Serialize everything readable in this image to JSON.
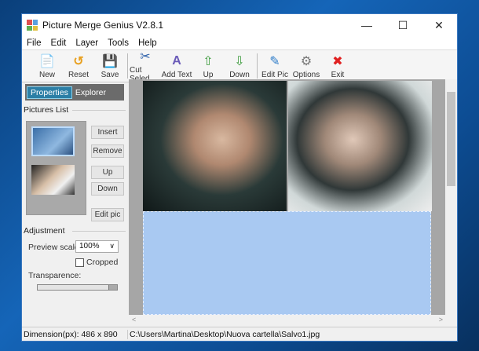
{
  "window": {
    "title": "Picture Merge Genius V2.8.1",
    "minimize": "—",
    "maximize": "☐",
    "close": "✕"
  },
  "menu": [
    "File",
    "Edit",
    "Layer",
    "Tools",
    "Help"
  ],
  "toolbar": [
    {
      "label": "New",
      "icon": "📄"
    },
    {
      "label": "Reset",
      "icon": "↺"
    },
    {
      "label": "Save",
      "icon": "💾"
    },
    {
      "label": "Cut Seled",
      "icon": "✂"
    },
    {
      "label": "Add Text",
      "icon": "A"
    },
    {
      "label": "Up",
      "icon": "⇧"
    },
    {
      "label": "Down",
      "icon": "⇩"
    },
    {
      "label": "Edit Pic",
      "icon": "✎"
    },
    {
      "label": "Options",
      "icon": "⚙"
    },
    {
      "label": "Exit",
      "icon": "✖"
    }
  ],
  "panel": {
    "tabs": [
      "Properties",
      "Explorer"
    ],
    "pictures_list": "Pictures List",
    "buttons": {
      "insert": "Insert",
      "remove": "Remove",
      "up": "Up",
      "down": "Down",
      "edit": "Edit pic"
    },
    "adjustment": "Adjustment",
    "preview_scale_label": "Preview scale:",
    "preview_scale": "100%",
    "cropped": "Cropped",
    "cropped_checked": false,
    "transparence": "Transparence:",
    "transparence_value": 100
  },
  "status": {
    "dimension": "Dimension(px): 486 x 890",
    "path": "C:\\Users\\Martina\\Desktop\\Nuova cartella\\Salvo1.jpg"
  },
  "scroll": {
    "left": "<",
    "right": ">",
    "up": "▲",
    "down": "▼"
  }
}
